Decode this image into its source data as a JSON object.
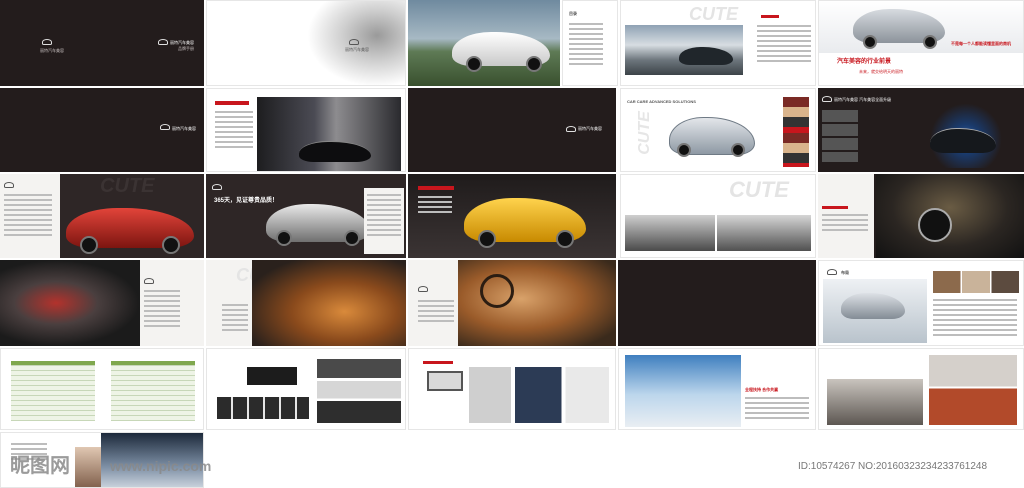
{
  "brand": {
    "name": "丽特汽车美容",
    "subtitle": "品牌手册"
  },
  "watermark": {
    "cute": "CUTE"
  },
  "pages": {
    "toc": {
      "title": "目录"
    },
    "vision": {
      "title": "不是每一个人都能读懂里面的商机",
      "headline": "汽车美容的行业前景",
      "tagline": "未来，就交给明天的丽特"
    },
    "advanced": {
      "heading": "CAR CARE ADVANCED SOLUTIONS"
    },
    "brand_upgrade": {
      "headline": "丽特汽车美容 汽车美容全面升级"
    },
    "promise": {
      "headline": "365天，见证尊贵品质！"
    },
    "layout": {
      "label": "布局"
    },
    "support": {
      "headline": "全程扶持 合作共赢"
    }
  },
  "footer": {
    "site_cn": "昵图网",
    "site_en": "www.nipic.com",
    "id_text": "ID:10574267 NO:20160323234233761248"
  }
}
